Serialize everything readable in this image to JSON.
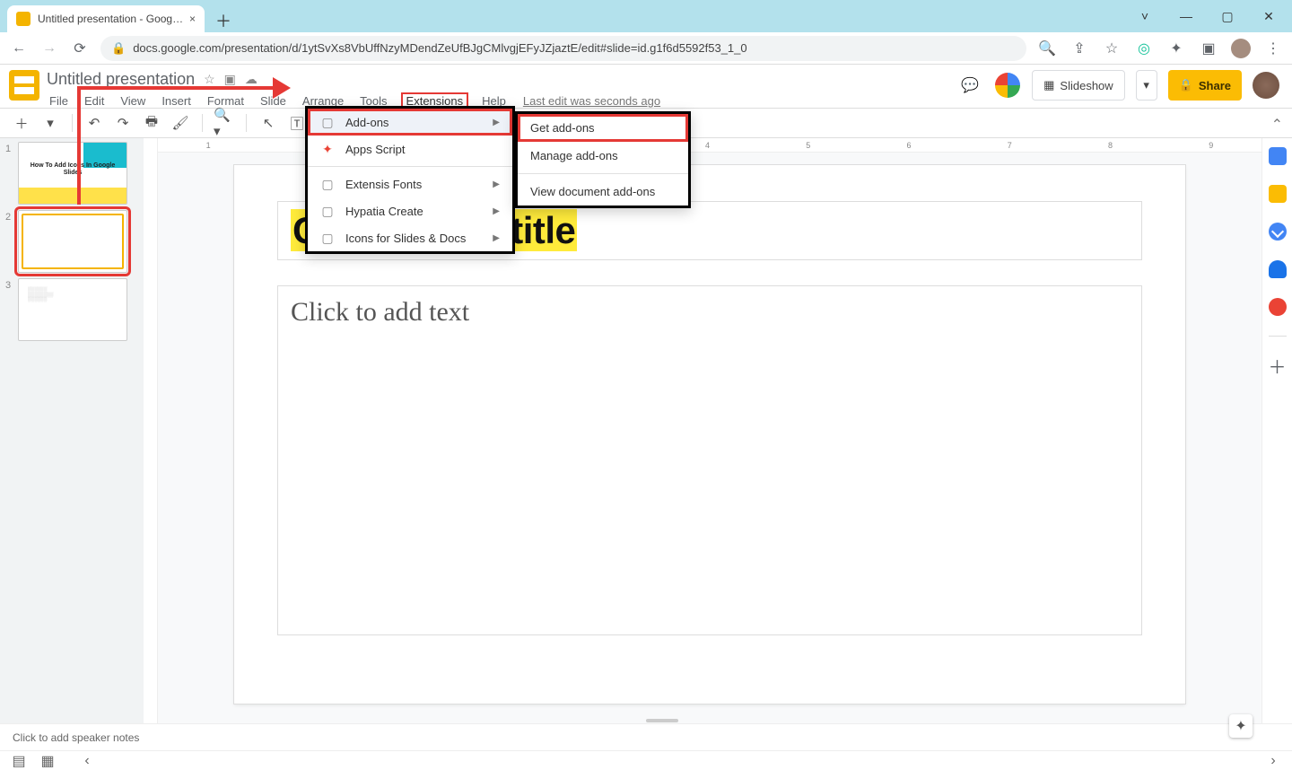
{
  "browser": {
    "tab_title": "Untitled presentation - Google S",
    "url": "docs.google.com/presentation/d/1ytSvXs8VbUffNzyMDendZeUfBJgCMlvgjEFyJZjaztE/edit#slide=id.g1f6d5592f53_1_0"
  },
  "doc": {
    "title": "Untitled presentation"
  },
  "menus": {
    "file": "File",
    "edit": "Edit",
    "view": "View",
    "insert": "Insert",
    "format": "Format",
    "slide": "Slide",
    "arrange": "Arrange",
    "tools": "Tools",
    "extensions": "Extensions",
    "help": "Help",
    "last_edit": "Last edit was seconds ago"
  },
  "header_right": {
    "slideshow": "Slideshow",
    "share": "Share"
  },
  "ext_menu": {
    "addons": "Add-ons",
    "apps_script": "Apps Script",
    "extensis": "Extensis Fonts",
    "hypatia": "Hypatia Create",
    "icons": "Icons for Slides & Docs"
  },
  "ext_sub": {
    "get": "Get add-ons",
    "manage": "Manage add-ons",
    "view_doc": "View document add-ons"
  },
  "thumbs": {
    "n1": "1",
    "n2": "2",
    "n3": "3",
    "t1_title": "How To Add Icons In Google Slides"
  },
  "slide": {
    "title_ph": "Click to add title",
    "body_ph": "Click to add text"
  },
  "ruler": [
    "1",
    "",
    "1",
    "2",
    "3",
    "4",
    "5",
    "6",
    "7",
    "8",
    "9"
  ],
  "speaker_notes": "Click to add speaker notes"
}
